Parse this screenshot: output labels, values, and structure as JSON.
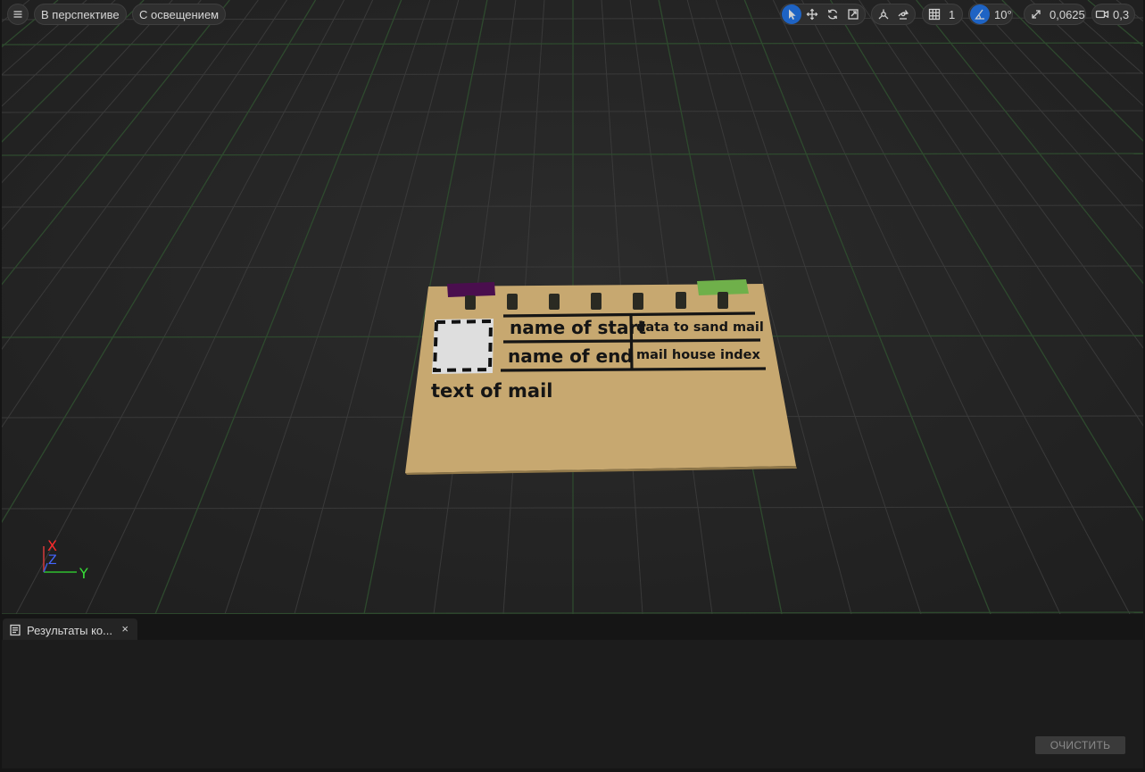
{
  "toolbar": {
    "menu_icon": "hamburger-menu-icon",
    "view_mode_label": "В перспективе",
    "lighting_label": "С освещением",
    "transform_tools": [
      "select-arrow-icon",
      "move-icon",
      "rotate-icon",
      "scale-icon"
    ],
    "grid_snap_value": "1",
    "angle_snap_value": "10°",
    "scale_snap_value": "0,0625",
    "camera_speed_value": "0,3",
    "accent_color": "#1e63c4"
  },
  "scene": {
    "letter": {
      "line1_left": "name of start",
      "line1_right": "data to sand mail",
      "line2_left": "name of end",
      "line2_right": "mail house index",
      "body": "text of mail",
      "paper_color": "#c7a870",
      "left_tab_color": "#4a0e4e",
      "right_tab_color": "#6fb04a"
    },
    "axis": {
      "x": "X",
      "y": "Y",
      "z": "Z"
    }
  },
  "bottom_panel": {
    "tab_label": "Результаты ко...",
    "tab_close": "×",
    "clear_button": "ОЧИСТИТЬ"
  }
}
